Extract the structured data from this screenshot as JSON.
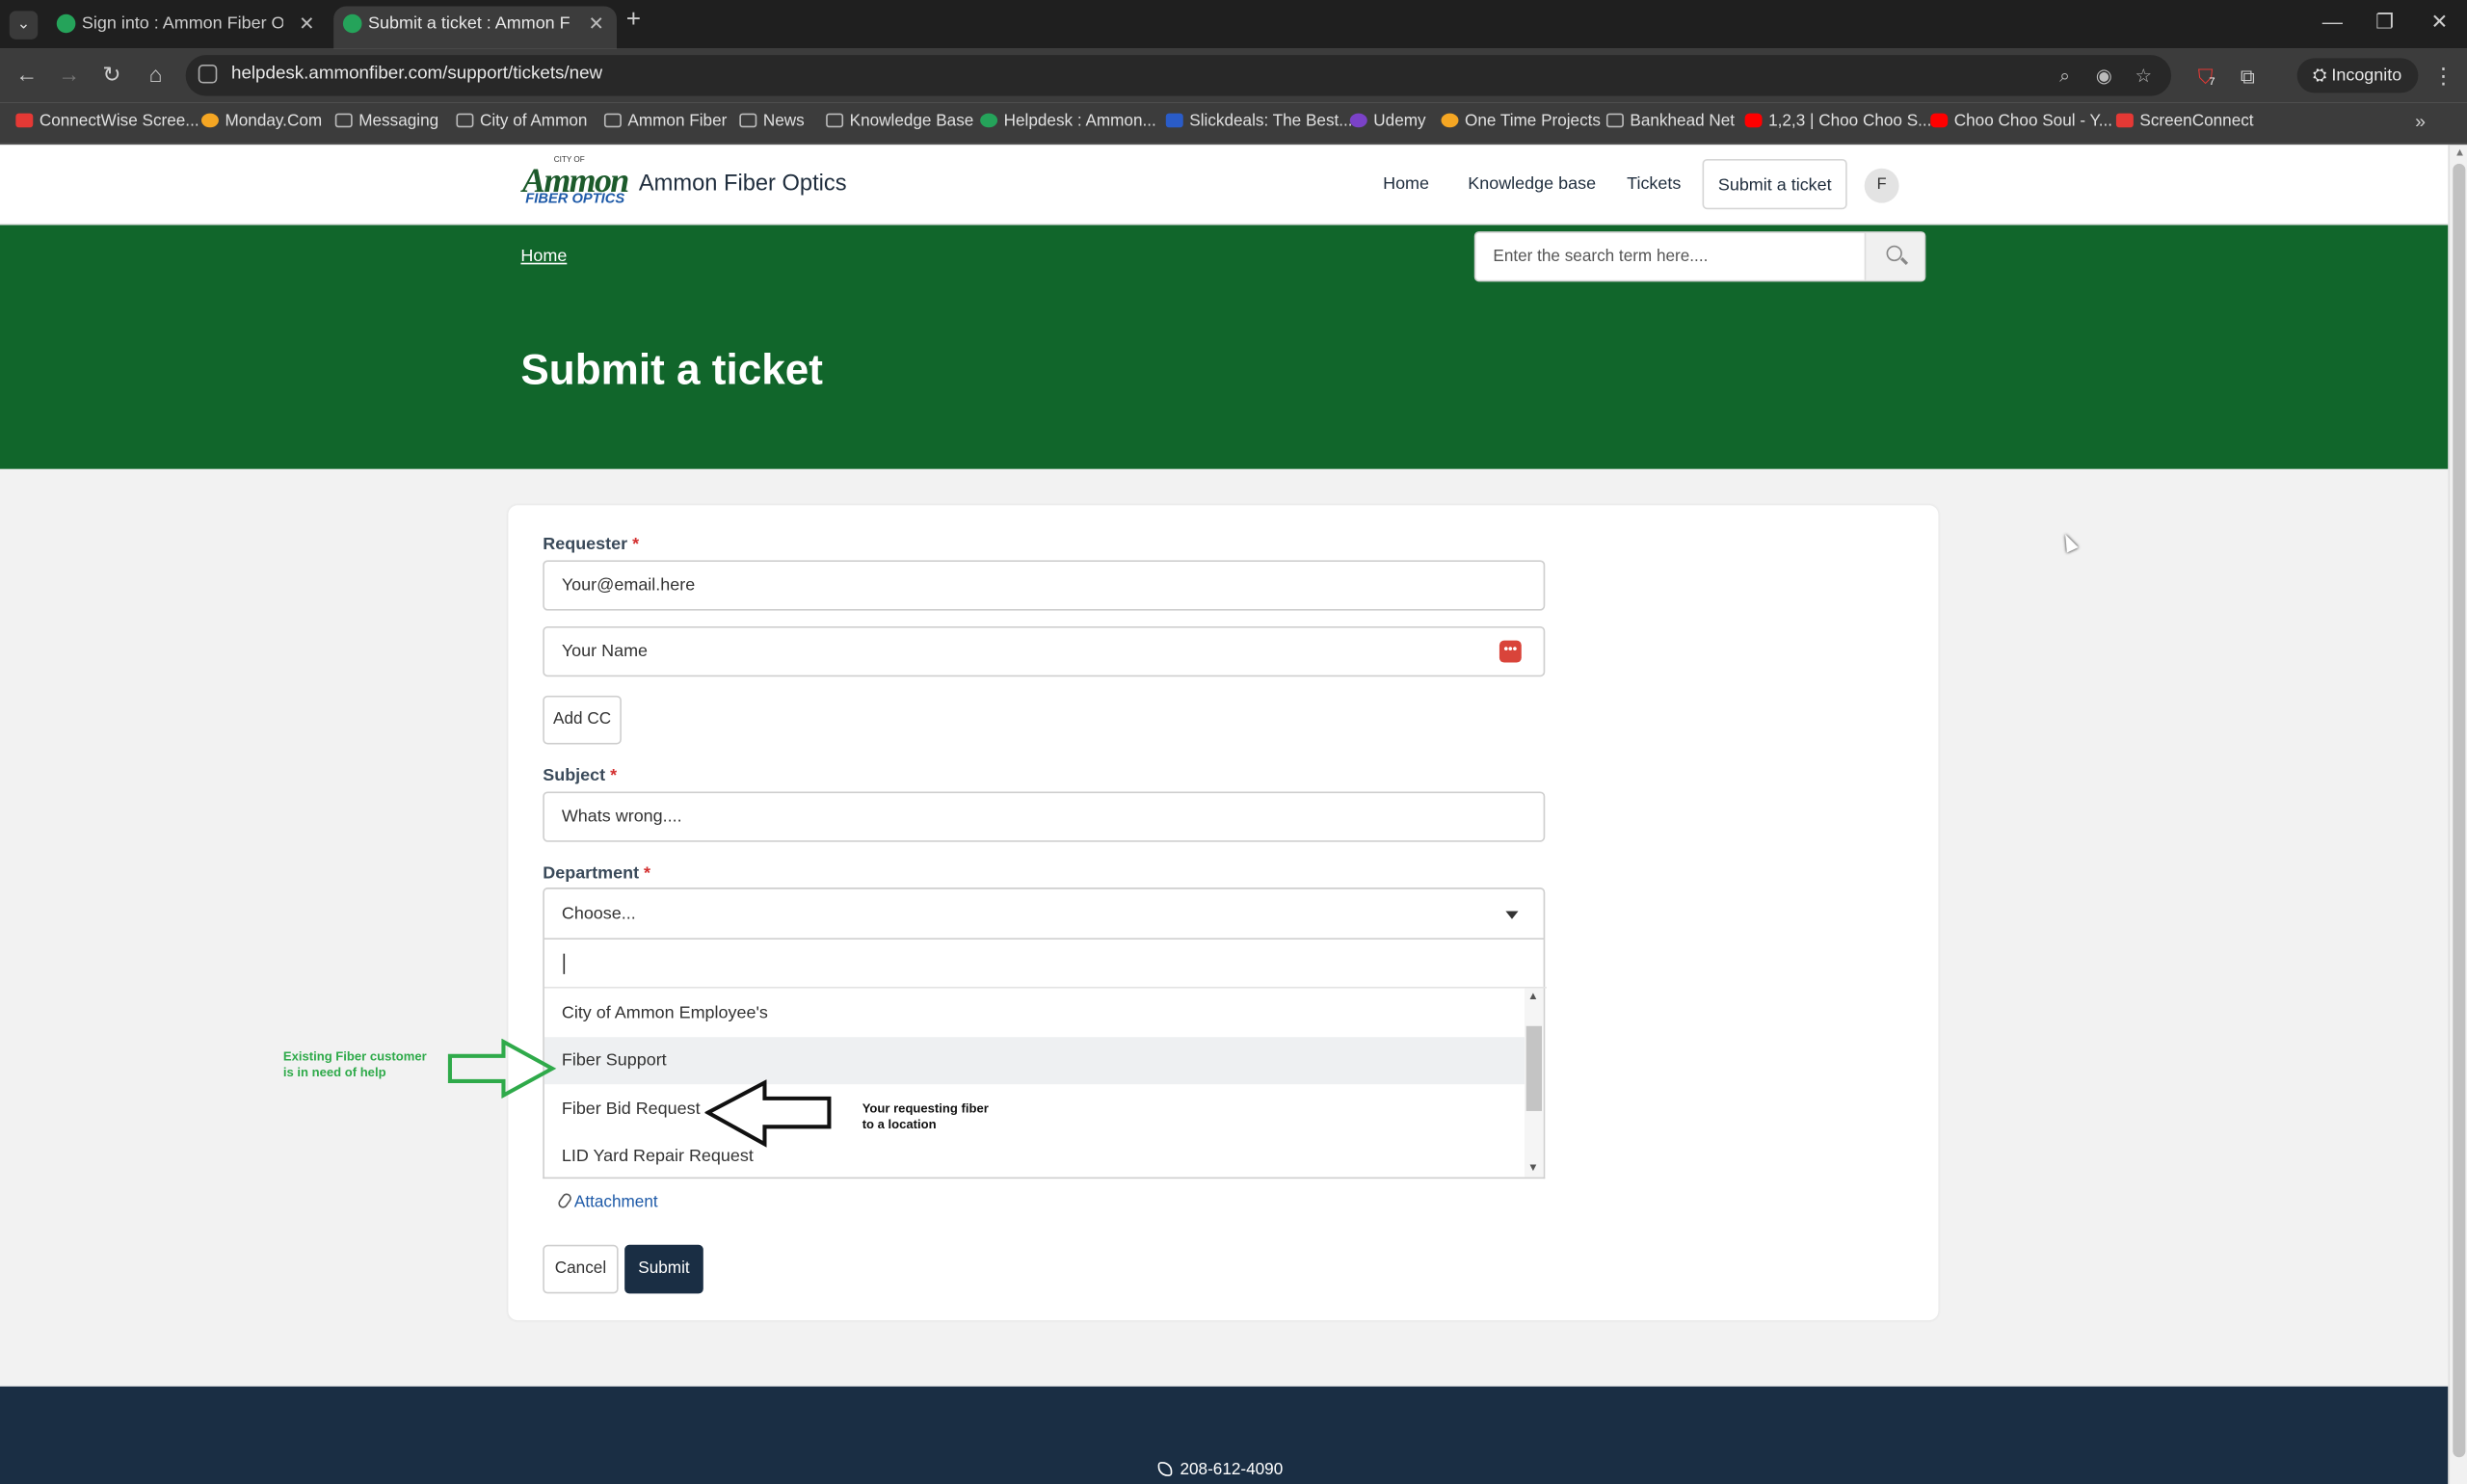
{
  "browser": {
    "tabs": [
      {
        "title": "Sign into : Ammon Fiber Optics"
      },
      {
        "title": "Submit a ticket : Ammon Fiber Optics"
      }
    ],
    "url": "helpdesk.ammonfiber.com/support/tickets/new",
    "incognito_label": "Incognito",
    "extension_badge": "7",
    "bookmarks": [
      "ConnectWise Scree...",
      "Monday.Com",
      "Messaging",
      "City of Ammon",
      "Ammon Fiber",
      "News",
      "Knowledge Base",
      "Helpdesk : Ammon...",
      "Slickdeals: The Best...",
      "Udemy",
      "One Time Projects",
      "Bankhead Net",
      "1,2,3 | Choo Choo S...",
      "Choo Choo Soul - Y...",
      "ScreenConnect"
    ]
  },
  "header": {
    "logo_top": "CITY OF",
    "logo_main": "Ammon",
    "logo_sub": "FIBER OPTICS",
    "site_name": "Ammon Fiber Optics",
    "nav": [
      "Home",
      "Knowledge base",
      "Tickets",
      "Submit a ticket"
    ],
    "avatar_initial": "F"
  },
  "hero": {
    "breadcrumb": "Home",
    "search_placeholder": "Enter the search term here....",
    "title": "Submit a ticket"
  },
  "form": {
    "requester_label": "Requester",
    "required_mark": "*",
    "email_value": "Your@email.here",
    "name_value": "Your Name",
    "add_cc": "Add CC",
    "subject_label": "Subject",
    "subject_value": "Whats wrong....",
    "department_label": "Department",
    "department_value": "Choose...",
    "options": [
      "City of Ammon Employee's",
      "Fiber Support",
      "Fiber Bid Request",
      "LID Yard Repair Request"
    ],
    "attachment": "Attachment",
    "cancel": "Cancel",
    "submit": "Submit"
  },
  "annotations": {
    "green_line1": "Existing Fiber customer",
    "green_line2": "is in need of help",
    "black_line1": "Your requesting fiber",
    "black_line2": "to a location",
    "green_color": "#2faa4a",
    "black_color": "#111111"
  },
  "footer": {
    "phone": "208-612-4090"
  },
  "colors": {
    "hero_green": "#11662b",
    "footer_navy": "#1a2e44",
    "submit_bg": "#1a2e44"
  }
}
